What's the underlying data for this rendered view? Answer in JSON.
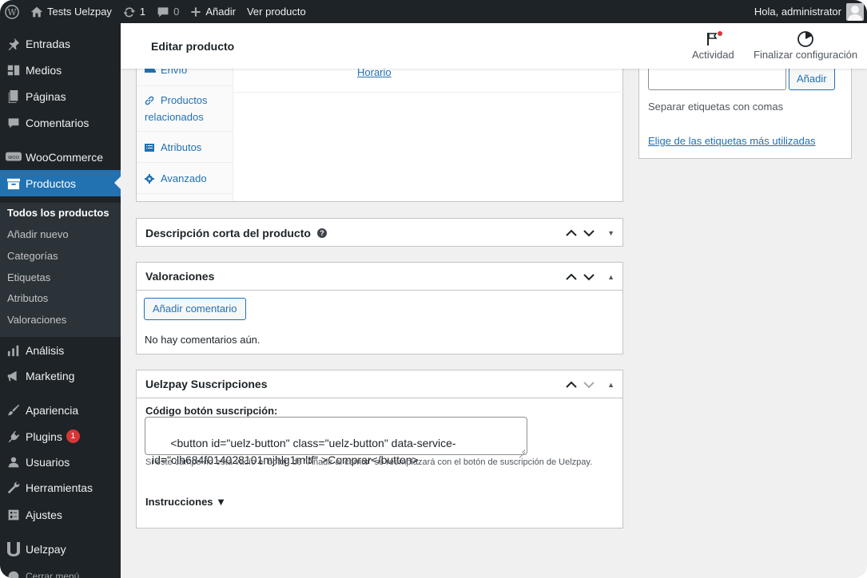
{
  "adminbar": {
    "site_name": "Tests Uelzpay",
    "updates_count": "1",
    "comments_count": "0",
    "new_label": "Añadir",
    "view_product_label": "Ver producto",
    "greeting": "Hola, administrator"
  },
  "sidebar": {
    "items": {
      "entradas": "Entradas",
      "medios": "Medios",
      "paginas": "Páginas",
      "comentarios": "Comentarios",
      "woocommerce": "WooCommerce",
      "productos": "Productos",
      "analisis": "Análisis",
      "marketing": "Marketing",
      "apariencia": "Apariencia",
      "plugins": "Plugins",
      "plugins_badge": "1",
      "usuarios": "Usuarios",
      "herramientas": "Herramientas",
      "ajustes": "Ajustes",
      "uelzpay": "Uelzpay",
      "cerrar": "Cerrar menú"
    },
    "submenu": {
      "todos": "Todos los productos",
      "anadir": "Añadir nuevo",
      "categorias": "Categorías",
      "etiquetas": "Etiquetas",
      "atributos": "Atributos",
      "valoraciones": "Valoraciones"
    }
  },
  "header": {
    "title": "Editar producto",
    "activity_label": "Actividad",
    "finish_label": "Finalizar configuración"
  },
  "product_data": {
    "tabs": {
      "envio": "Envío",
      "relacionados": "Productos relacionados",
      "atributos": "Atributos",
      "avanzado": "Avanzado"
    },
    "horario_link": "Horario"
  },
  "short_description": {
    "title": "Descripción corta del producto",
    "help": "?"
  },
  "reviews": {
    "title": "Valoraciones",
    "add_button": "Añadir comentario",
    "empty_text": "No hay comentarios aún."
  },
  "uelzpay_box": {
    "title": "Uelzpay Suscripciones",
    "field_label": "Código botón suscripción:",
    "field_value": "<button id=\"uelz-button\" class=\"uelz-button\" data-service-id=\"clh684f014028101mjhlg1mltf\" >Comprar</button>",
    "help_text": "Si este campo no está vacío el botón de \"Añadir al carrito\" se reemplazará con el botón de suscripción de Uelzpay.",
    "instructions_label": "Instrucciones ▼"
  },
  "tags": {
    "add_button": "Añadir",
    "separator_hint": "Separar etiquetas con comas",
    "most_used_link": "Elige de las etiquetas más utilizadas"
  },
  "colors": {
    "admin_dark": "#1d2327",
    "accent_blue": "#2271b1",
    "badge_red": "#d63638"
  }
}
